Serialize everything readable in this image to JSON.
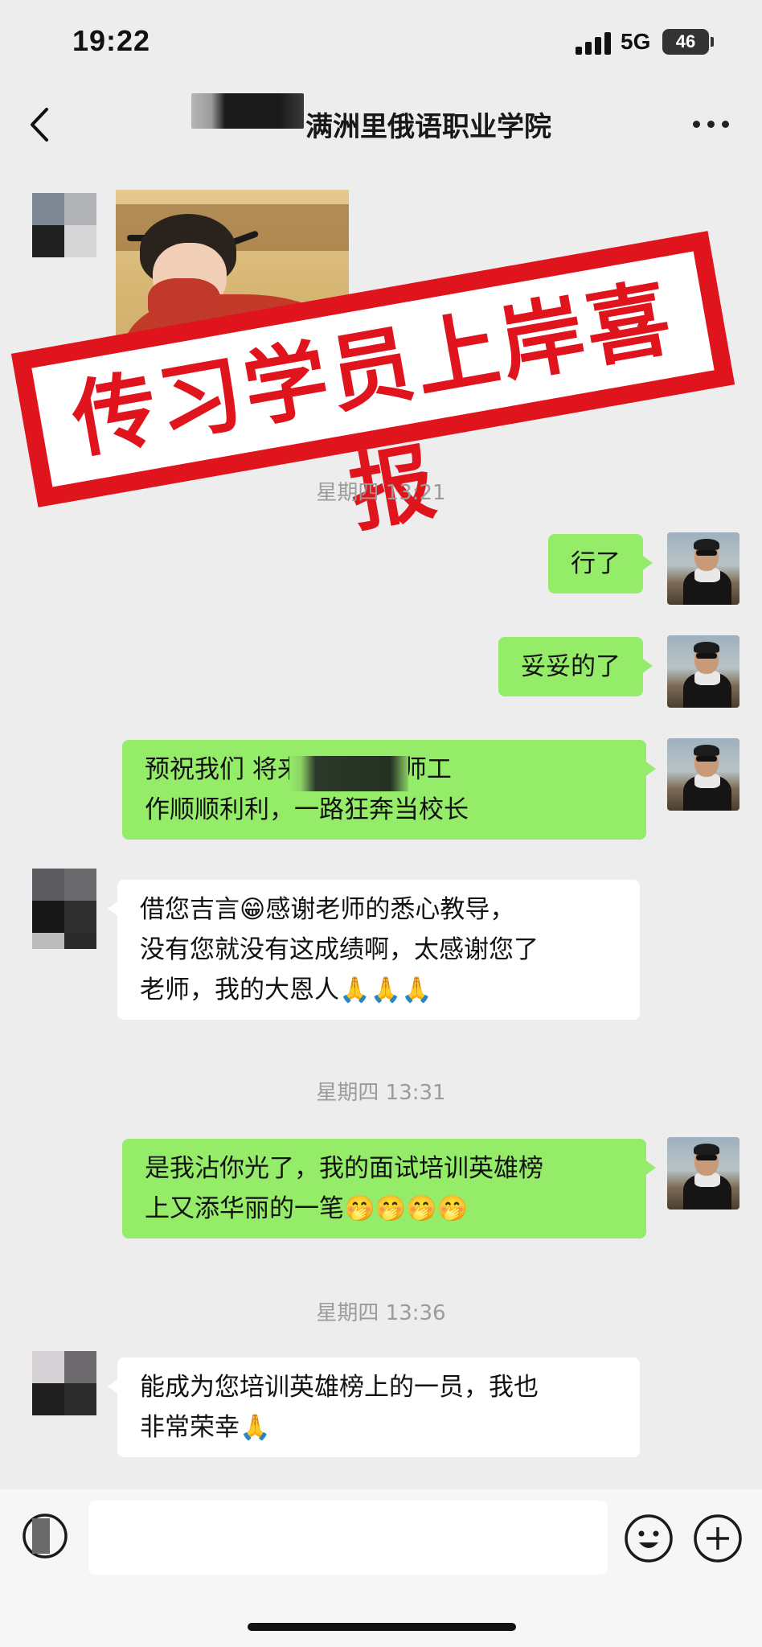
{
  "status_bar": {
    "time": "19:22",
    "network": "5G",
    "battery": "46"
  },
  "header": {
    "title": "满洲里俄语职业学院",
    "more": "more-options"
  },
  "stamp_text": "传习学员上岸喜报",
  "messages": [
    {
      "side": "right",
      "lines": [
        "行了"
      ]
    },
    {
      "side": "right",
      "lines": [
        "妥妥的了"
      ]
    },
    {
      "side": "right",
      "lines": [
        "预祝我们          将来的大学老师工",
        "作顺顺利利，一路狂奔当校长"
      ]
    },
    {
      "side": "left",
      "lines": [
        "借您吉言😁感谢老师的悉心教导，",
        "没有您就没有这成绩啊，太感谢您了",
        "老师，我的大恩人🙏🙏🙏"
      ]
    },
    {
      "side": "right",
      "lines": [
        "是我沾你光了，我的面试培训英雄榜",
        "上又添华丽的一笔🤭🤭🤭🤭"
      ]
    },
    {
      "side": "left",
      "lines": [
        "能成为您培训英雄榜上的一员，我也",
        "非常荣幸🙏"
      ]
    }
  ],
  "timestamps": [
    "星期四 13:21",
    "星期四 13:31",
    "星期四 13:36"
  ],
  "colors": {
    "bubble_green": "#95ec69",
    "stamp_red": "#e0141d",
    "background": "#ededed"
  }
}
